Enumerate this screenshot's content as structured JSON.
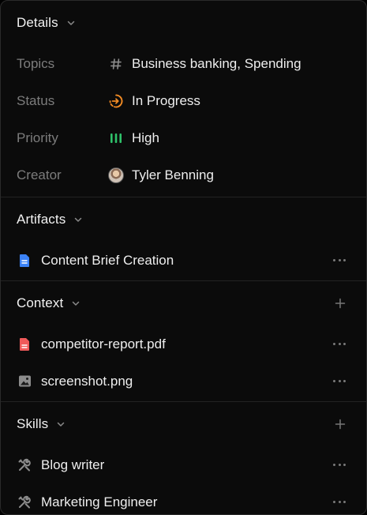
{
  "details": {
    "title": "Details",
    "properties": [
      {
        "label": "Topics",
        "icon": "hash-icon",
        "value": "Business banking, Spending"
      },
      {
        "label": "Status",
        "icon": "in-progress-icon",
        "value": "In Progress"
      },
      {
        "label": "Priority",
        "icon": "priority-high-icon",
        "value": "High"
      },
      {
        "label": "Creator",
        "icon": "avatar",
        "value": "Tyler Benning"
      }
    ]
  },
  "artifacts": {
    "title": "Artifacts",
    "items": [
      {
        "label": "Content Brief Creation",
        "icon": "document-icon"
      }
    ]
  },
  "context": {
    "title": "Context",
    "items": [
      {
        "label": "competitor-report.pdf",
        "icon": "pdf-file-icon"
      },
      {
        "label": "screenshot.png",
        "icon": "image-file-icon"
      }
    ]
  },
  "skills": {
    "title": "Skills",
    "items": [
      {
        "label": "Blog writer",
        "icon": "tools-icon"
      },
      {
        "label": "Marketing Engineer",
        "icon": "tools-icon"
      }
    ]
  },
  "colors": {
    "background": "#0b0b0b",
    "status_orange": "#f08a24",
    "priority_green": "#2fc26a",
    "doc_blue": "#3b82f6",
    "pdf_red": "#ef5a5a"
  }
}
